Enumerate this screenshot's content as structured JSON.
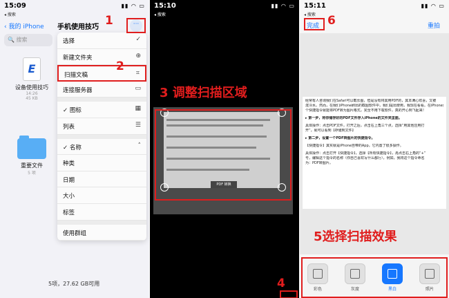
{
  "panel1": {
    "status_time": "15:09",
    "status_sub": "◂ 搜索",
    "back_label": "‹ 我的 iPhone",
    "title": "手机使用技巧",
    "search_placeholder": "🔍 搜索",
    "files": [
      {
        "name": "设备使用技巧",
        "meta1": "14:26",
        "meta2": "45 KB"
      },
      {
        "name": "重要文件",
        "meta1": "5 项",
        "meta2": ""
      }
    ],
    "menu": [
      {
        "label": "选择",
        "icon": "✓"
      },
      {
        "label": "新建文件夹",
        "icon": "⊕"
      },
      {
        "label": "扫描文稿",
        "icon": "⌗"
      },
      {
        "label": "连接服务器",
        "icon": "▭"
      },
      {
        "label": "✓ 图标",
        "icon": "▦"
      },
      {
        "label": "列表",
        "icon": "☰"
      },
      {
        "label": "✓ 名称",
        "icon": "˄"
      },
      {
        "label": "种类",
        "icon": ""
      },
      {
        "label": "日期",
        "icon": ""
      },
      {
        "label": "大小",
        "icon": ""
      },
      {
        "label": "标签",
        "icon": ""
      },
      {
        "label": "使用群组",
        "icon": ""
      }
    ],
    "footer": "5项，27.62 GB可用",
    "callouts": {
      "step1": "1",
      "step2": "2"
    }
  },
  "panel2": {
    "status_time": "15:10",
    "status_sub": "◂ 搜索",
    "caption": "3 调整扫描区域",
    "chip": "PDF 转换",
    "step4": "4"
  },
  "panel3": {
    "status_time": "15:11",
    "status_sub": "◂ 搜索",
    "done": "完成",
    "retake": "重拍",
    "step6": "6",
    "caption": "5选择扫描效果",
    "doc_lines": [
      "经常有人咨询我们在Safari可以截长图，但是没有将其用PDF的，其本满心欢喜，又被",
      "泼冷水。然而，在我们iPhone刷出的截图软件中，我们提出使用，我现在看看。在iPhone设置一",
      "个快捷指令就能将PDF转为图片格式，完全不用下载软件，真的开心到飞起来！",
      "▸ 第一步，将你储存好的PDF文件存入iPhone的文件夹里面。",
      "具体操作：点击PDF文件，打开之后，点击右上角三个点，选择“用其他应用打",
      "开”，就可以看到【存储到文件】",
      "▸ 第二步，设置一个PDF转图片的快捷指令。",
      "【快捷指令】其实就是iPhone自带的App，它内置了很多操作。",
      "具体操作：点击打开【快捷指令】，选择【所有快捷指令】，再点击右上角的“+”",
      "号，编辑这个指令的名称（你自己喜欢写什么都行），例如，我将这个指令命名",
      "为：PDF转图片。"
    ],
    "filters": [
      {
        "label": "彩色"
      },
      {
        "label": "灰度"
      },
      {
        "label": "黑白"
      },
      {
        "label": "照片"
      }
    ]
  }
}
